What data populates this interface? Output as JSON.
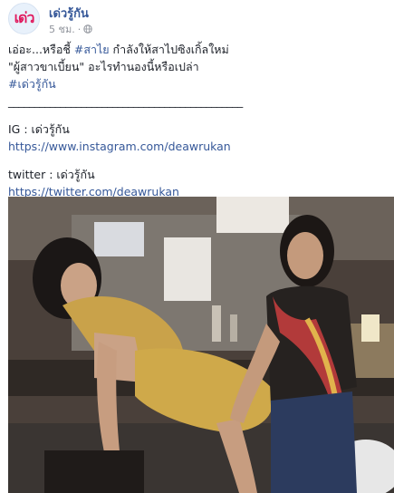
{
  "header": {
    "page_name": "เด่วรู้กัน",
    "timestamp": "5 ชม.",
    "separator": "·",
    "avatar_text": "เด่ว",
    "privacy_icon": "globe-icon"
  },
  "post": {
    "line1_prefix": "เอ่อะ...หรือชี้ ",
    "line1_hashtag": "#สาไย",
    "line1_suffix": " กำลังให้สาไปซิงเกิ้ลใหม่",
    "line2": "\"ผู้สาวขาเบี้ยน\" อะไรทำนองนี้หรือเปล่า",
    "line3_hashtag": "#เด่วรู้กัน",
    "divider": "_____________________________________________",
    "ig_label": "IG : เด่วรู้กัน",
    "ig_link": "https://www.instagram.com/deawrukan",
    "twitter_label": "twitter : เด่วรู้กัน",
    "twitter_link": "https://twitter.com/deawrukan"
  },
  "colors": {
    "link": "#365899",
    "meta": "#90949c",
    "text": "#1d2129",
    "brand": "#e0195e"
  }
}
